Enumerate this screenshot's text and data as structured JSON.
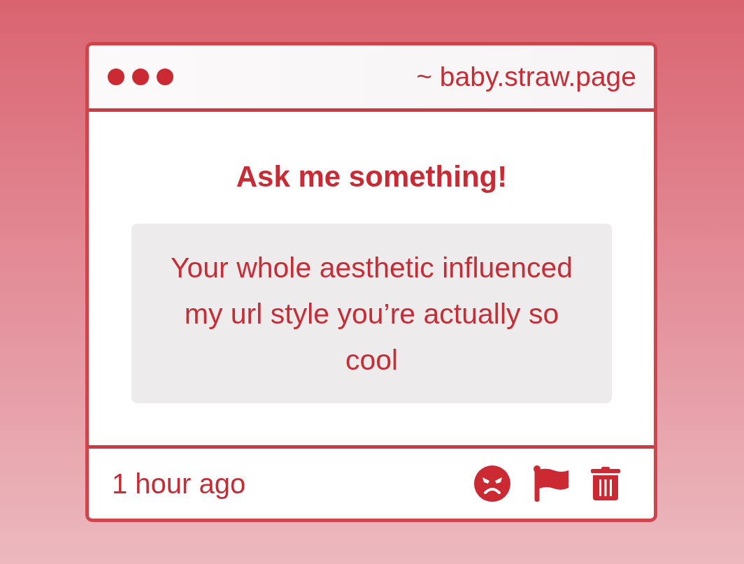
{
  "window": {
    "address": "~ baby.straw.page"
  },
  "question": {
    "prompt": "Ask me something!",
    "message": "Your whole aesthetic influenced my url style you’re actually so cool"
  },
  "footer": {
    "time": "1 hour ago",
    "actions": [
      {
        "kind": "angry"
      },
      {
        "kind": "flag"
      },
      {
        "kind": "trash"
      }
    ]
  }
}
